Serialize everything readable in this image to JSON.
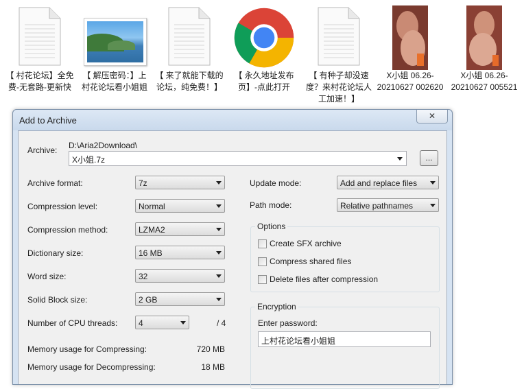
{
  "files": [
    {
      "icon": "text-file-icon",
      "label": "【 村花论坛】全免费-无套路-更新快"
    },
    {
      "icon": "image-file-icon",
      "label": "【 解压密码：】上村花论坛看小姐姐"
    },
    {
      "icon": "text-file-icon",
      "label": "【 来了就能下载的论坛，纯免费！】"
    },
    {
      "icon": "chrome-icon",
      "label": "【 永久地址发布页】-点此打开"
    },
    {
      "icon": "text-file-icon",
      "label": "【 有种子却没速度？来村花论坛人工加速！】"
    },
    {
      "icon": "video-thumbnail",
      "label": "X小姐 06.26-20210627 002620"
    },
    {
      "icon": "video-thumbnail",
      "label": "X小姐 06.26-20210627 005521"
    }
  ],
  "dialog": {
    "title": "Add to Archive",
    "close_label": "✕",
    "archive": {
      "label": "Archive:",
      "path": "D:\\Aria2Download\\",
      "value": "X小姐.7z",
      "browse_label": "..."
    },
    "left": {
      "archive_format": {
        "label": "Archive format:",
        "value": "7z"
      },
      "compression_level": {
        "label": "Compression level:",
        "value": "Normal"
      },
      "compression_method": {
        "label": "Compression method:",
        "value": "LZMA2"
      },
      "dictionary_size": {
        "label": "Dictionary size:",
        "value": "16 MB"
      },
      "word_size": {
        "label": "Word size:",
        "value": "32"
      },
      "solid_block_size": {
        "label": "Solid Block size:",
        "value": "2 GB"
      },
      "cpu_threads": {
        "label": "Number of CPU threads:",
        "value": "4",
        "total": "/ 4"
      },
      "memory_compress": {
        "label": "Memory usage for Compressing:",
        "value": "720 MB"
      },
      "memory_decompress": {
        "label": "Memory usage for Decompressing:",
        "value": "18 MB"
      }
    },
    "right": {
      "update_mode": {
        "label": "Update mode:",
        "value": "Add and replace files"
      },
      "path_mode": {
        "label": "Path mode:",
        "value": "Relative pathnames"
      },
      "options": {
        "title": "Options",
        "create_sfx": "Create SFX archive",
        "compress_shared": "Compress shared files",
        "delete_after": "Delete files after compression"
      },
      "encryption": {
        "title": "Encryption",
        "password_label": "Enter password:",
        "password_value": "上村花论坛看小姐姐"
      }
    }
  }
}
